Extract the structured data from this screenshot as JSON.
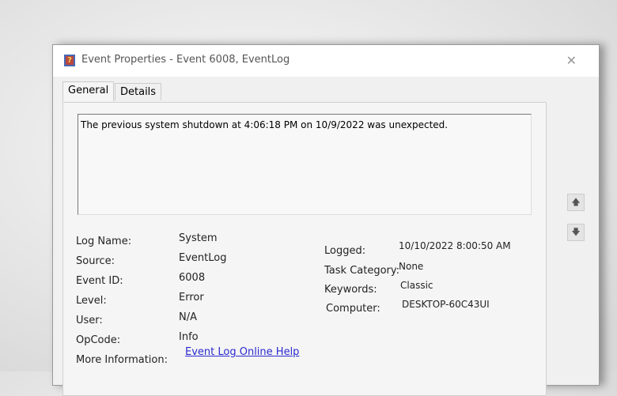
{
  "window": {
    "title": "Event Properties - Event 6008, EventLog",
    "close": "✕"
  },
  "tabs": [
    {
      "label": "General"
    },
    {
      "label": "Details"
    }
  ],
  "message": "The previous system shutdown at 4:06:18 PM on 10/9/2022 was unexpected.",
  "left_fields": [
    {
      "label": "Log Name:",
      "value": "System"
    },
    {
      "label": "Source:",
      "value": "EventLog"
    },
    {
      "label": "Event ID:",
      "value": "6008"
    },
    {
      "label": "Level:",
      "value": "Error"
    },
    {
      "label": "User:",
      "value": "N/A"
    },
    {
      "label": "OpCode:",
      "value": "Info"
    },
    {
      "label": "More Information:",
      "value": "Event Log Online Help"
    }
  ],
  "right_fields": [
    {
      "label": "Logged:",
      "value": "10/10/2022 8:00:50 AM"
    },
    {
      "label": "Task Category:",
      "value": "None"
    },
    {
      "label": "Keywords:",
      "value": "Classic"
    },
    {
      "label": "Computer:",
      "value": "DESKTOP-60C43UI"
    }
  ],
  "nav": {
    "up": "🡅",
    "down": "🡇"
  }
}
